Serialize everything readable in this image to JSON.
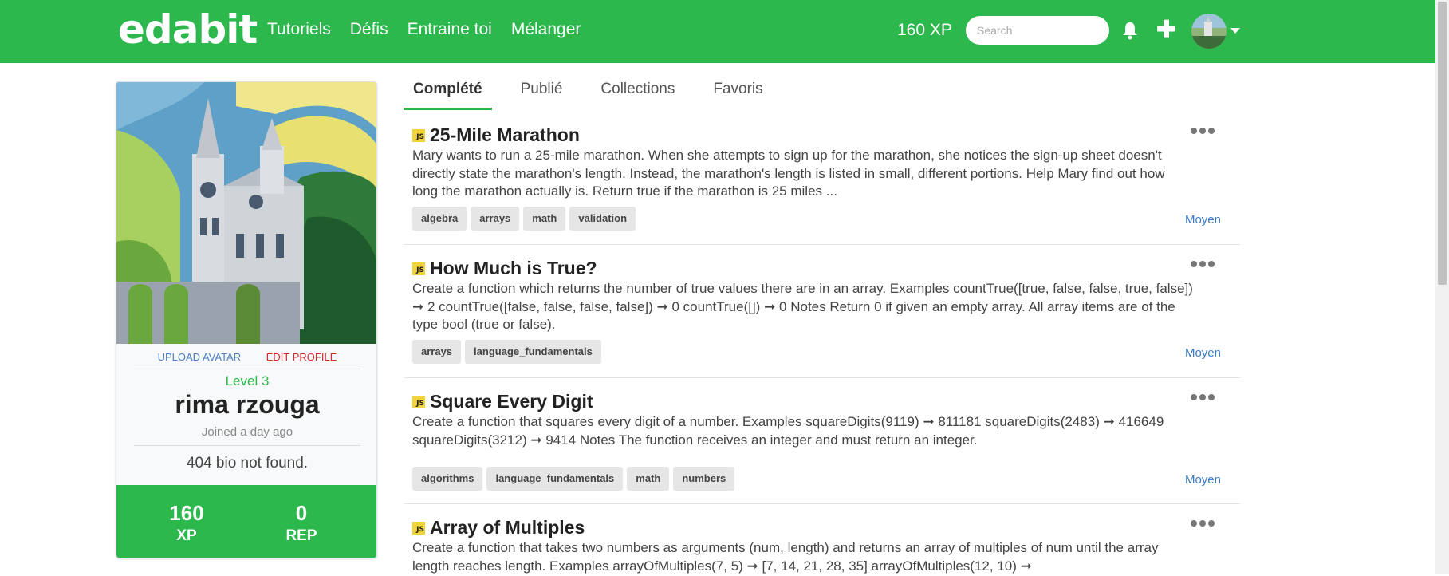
{
  "header": {
    "logo": "edabit",
    "nav": [
      "Tutoriels",
      "Défis",
      "Entraine toi",
      "Mélanger"
    ],
    "xp": "160 XP",
    "search_placeholder": "Search"
  },
  "profile": {
    "upload_avatar": "UPLOAD AVATAR",
    "edit_profile": "EDIT PROFILE",
    "level": "Level 3",
    "name": "rima rzouga",
    "joined": "Joined a day ago",
    "bio": "404 bio not found.",
    "xp_value": "160",
    "xp_label": "XP",
    "rep_value": "0",
    "rep_label": "REP"
  },
  "tabs": [
    "Complété",
    "Publié",
    "Collections",
    "Favoris"
  ],
  "challenges": [
    {
      "lang": "JS",
      "title": "25-Mile Marathon",
      "description": "Mary wants to run a 25-mile marathon. When she attempts to sign up for the marathon, she notices the sign-up sheet doesn't directly state the marathon's length. Instead, the marathon's length is listed in small, different portions. Help Mary find out how long the marathon actually is. Return true if the marathon is 25 miles ...",
      "tags": [
        "algebra",
        "arrays",
        "math",
        "validation"
      ],
      "difficulty": "Moyen"
    },
    {
      "lang": "JS",
      "title": "How Much is True?",
      "description": "Create a function which returns the number of true values there are in an array. Examples countTrue([true, false, false, true, false]) ➞ 2 countTrue([false, false, false, false]) ➞ 0 countTrue([]) ➞ 0 Notes Return 0 if given an empty array. All array items are of the type bool (true or false).",
      "tags": [
        "arrays",
        "language_fundamentals"
      ],
      "difficulty": "Moyen"
    },
    {
      "lang": "JS",
      "title": "Square Every Digit",
      "description": "Create a function that squares every digit of a number. Examples squareDigits(9119) ➞ 811181 squareDigits(2483) ➞ 416649 squareDigits(3212) ➞ 9414 Notes The function receives an integer and must return an integer.",
      "tags": [
        "algorithms",
        "language_fundamentals",
        "math",
        "numbers"
      ],
      "difficulty": "Moyen"
    },
    {
      "lang": "JS",
      "title": "Array of Multiples",
      "description": "Create a function that takes two numbers as arguments (num, length) and returns an array of multiples of num until the array length reaches length. Examples arrayOfMultiples(7, 5) ➞ [7, 14, 21, 28, 35] arrayOfMultiples(12, 10) ➞",
      "tags": [],
      "difficulty": ""
    }
  ],
  "colors": {
    "brand": "#2cb84d",
    "link": "#3a7cc4",
    "edit": "#d62b2b",
    "js_badge": "#f0d43a"
  }
}
